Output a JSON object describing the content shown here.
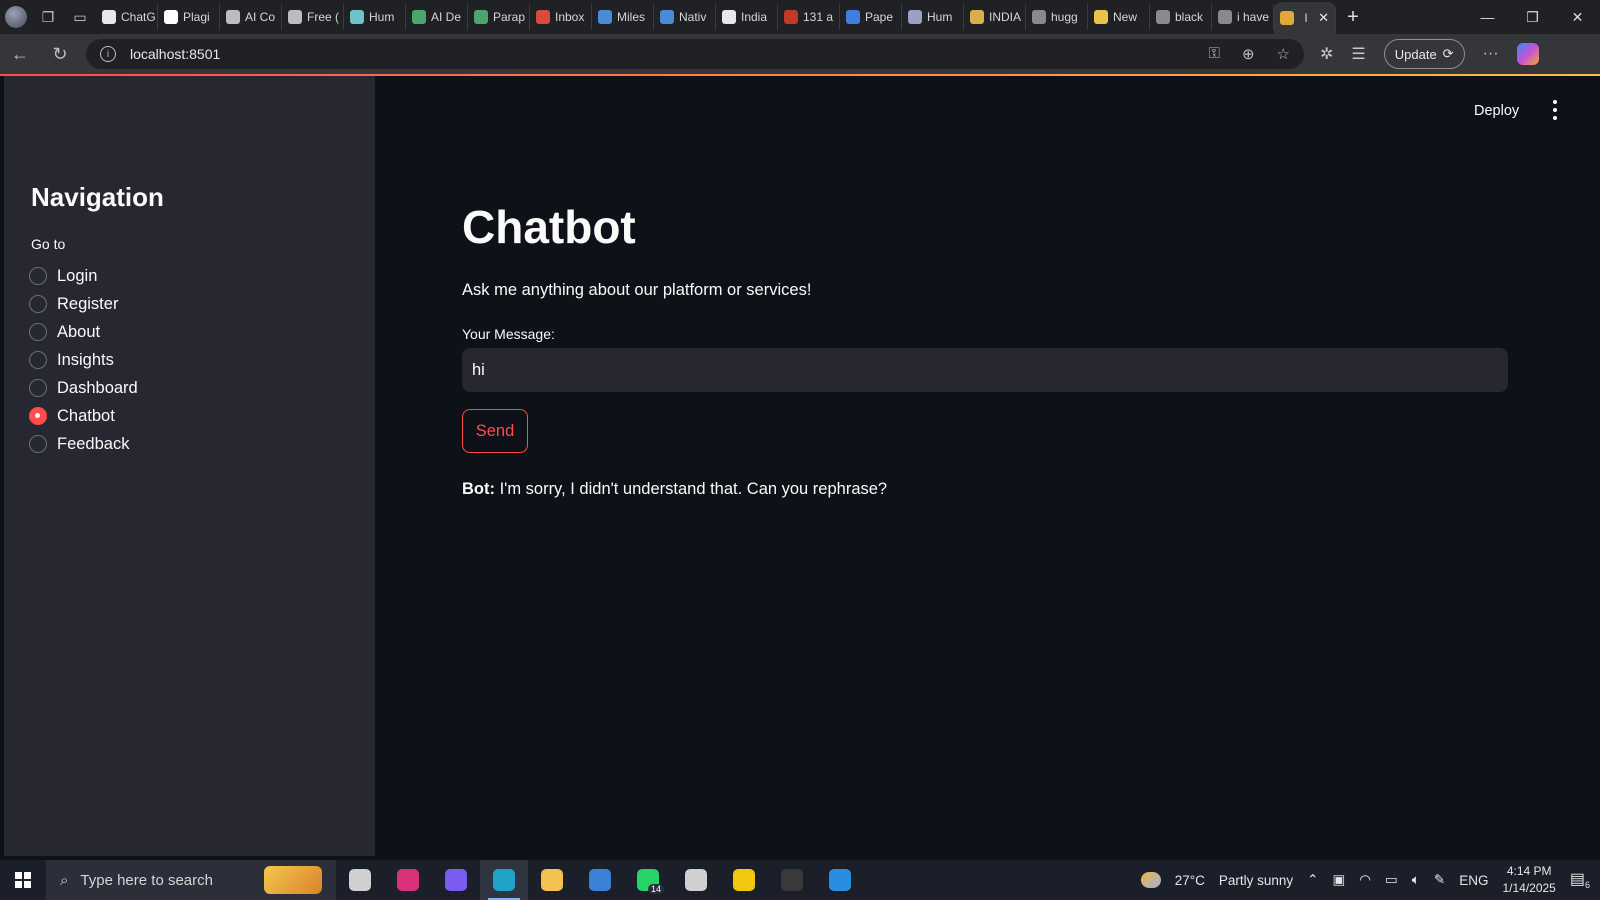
{
  "browser": {
    "tabs": [
      {
        "label": "ChatG",
        "color": "#e8e8e8"
      },
      {
        "label": "Plagi",
        "color": "#ffffff"
      },
      {
        "label": "AI Co",
        "color": "#bdbdbd"
      },
      {
        "label": "Free (",
        "color": "#bdbdbd"
      },
      {
        "label": "Hum",
        "color": "#6fc3c8"
      },
      {
        "label": "AI De",
        "color": "#4ea56b"
      },
      {
        "label": "Parap",
        "color": "#4ea56b"
      },
      {
        "label": "Inbox",
        "color": "#d84a3a"
      },
      {
        "label": "Miles",
        "color": "#4b8bd6"
      },
      {
        "label": "Nativ",
        "color": "#4b8bd6"
      },
      {
        "label": "India",
        "color": "#e8e8e8"
      },
      {
        "label": "131 a",
        "color": "#c0392b"
      },
      {
        "label": "Pape",
        "color": "#3f7fe0"
      },
      {
        "label": "Hum",
        "color": "#9aa0c4"
      },
      {
        "label": "INDIA",
        "color": "#d8b04a"
      },
      {
        "label": "hugg",
        "color": "#8a8a8a"
      },
      {
        "label": "New",
        "color": "#e8c24a"
      },
      {
        "label": "black",
        "color": "#8a8a8a"
      },
      {
        "label": "i have",
        "color": "#8a8a8a"
      }
    ],
    "active_tab_label": "I",
    "url": "localhost:8501",
    "update_label": "Update"
  },
  "app": {
    "deploy_label": "Deploy",
    "sidebar": {
      "title": "Navigation",
      "goto_label": "Go to",
      "options": [
        {
          "label": "Login",
          "selected": false
        },
        {
          "label": "Register",
          "selected": false
        },
        {
          "label": "About",
          "selected": false
        },
        {
          "label": "Insights",
          "selected": false
        },
        {
          "label": "Dashboard",
          "selected": false
        },
        {
          "label": "Chatbot",
          "selected": true
        },
        {
          "label": "Feedback",
          "selected": false
        }
      ]
    },
    "main": {
      "title": "Chatbot",
      "subtitle": "Ask me anything about our platform or services!",
      "message_label": "Your Message:",
      "message_value": "hi",
      "send_label": "Send",
      "bot_prefix": "Bot:",
      "bot_reply": "I'm sorry, I didn't understand that. Can you rephrase?"
    }
  },
  "taskbar": {
    "search_placeholder": "Type here to search",
    "apps": [
      {
        "name": "task-view",
        "color": "#d0d0d0"
      },
      {
        "name": "instagram",
        "color": "#d9317a"
      },
      {
        "name": "copilot",
        "color": "#7a5cf0"
      },
      {
        "name": "edge",
        "color": "#1fa3c7",
        "active": true
      },
      {
        "name": "file-explorer",
        "color": "#f2c14e"
      },
      {
        "name": "microsoft-store",
        "color": "#3b82d6"
      },
      {
        "name": "whatsapp",
        "color": "#25d366",
        "badge": "14"
      },
      {
        "name": "settings",
        "color": "#d0d0d0"
      },
      {
        "name": "power-bi",
        "color": "#f2c811"
      },
      {
        "name": "terminal",
        "color": "#3a3a3a"
      },
      {
        "name": "vscode",
        "color": "#2a8ee0"
      }
    ],
    "weather_temp": "27°C",
    "weather_desc": "Partly sunny",
    "language": "ENG",
    "time": "4:14 PM",
    "date": "1/14/2025",
    "notification_count": "6"
  }
}
